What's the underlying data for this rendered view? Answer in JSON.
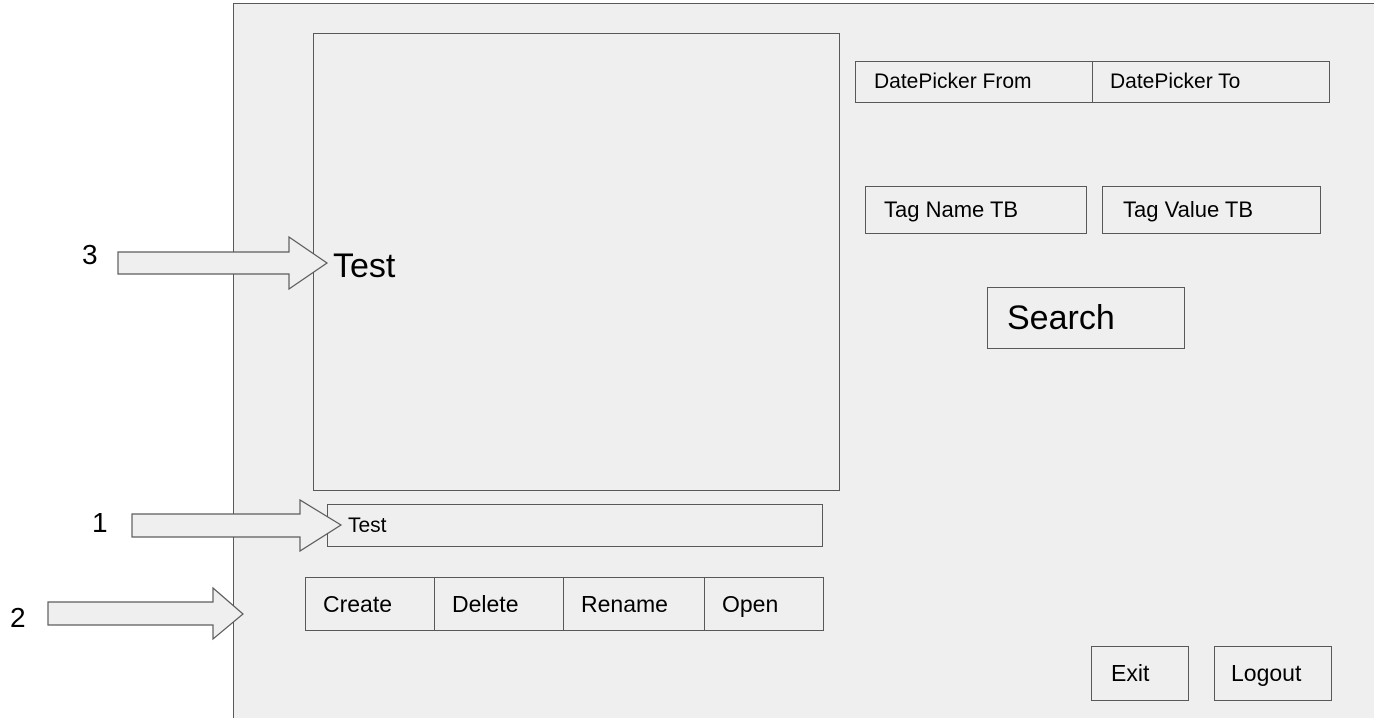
{
  "window": {
    "background": "#efefef",
    "border_color": "#595959"
  },
  "list_panel": {
    "text": "Test"
  },
  "name_field": {
    "value": "Test"
  },
  "actions": [
    {
      "key": "create",
      "label": "Create"
    },
    {
      "key": "delete",
      "label": "Delete"
    },
    {
      "key": "rename",
      "label": "Rename"
    },
    {
      "key": "open",
      "label": "Open"
    }
  ],
  "date_range": {
    "from_label": "DatePicker From",
    "to_label": "DatePicker To"
  },
  "tags": {
    "name_label": "Tag Name TB",
    "value_label": "Tag Value TB"
  },
  "search_label": "Search",
  "footer": {
    "exit_label": "Exit",
    "logout_label": "Logout"
  },
  "callouts": [
    {
      "number": "3",
      "target": "list-panel",
      "icon": "arrow-right-icon"
    },
    {
      "number": "1",
      "target": "name-field",
      "icon": "arrow-right-icon"
    },
    {
      "number": "2",
      "target": "action-buttons",
      "icon": "arrow-right-icon"
    }
  ]
}
